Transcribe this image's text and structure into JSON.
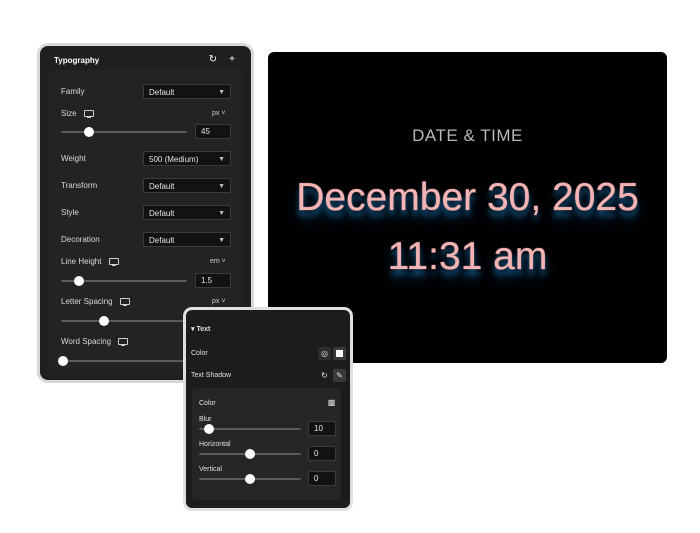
{
  "typography": {
    "title": "Typography",
    "reset_icon": "↻",
    "add_icon": "+",
    "family": {
      "label": "Family",
      "value": "Default"
    },
    "size": {
      "label": "Size",
      "unit": "px",
      "value": "45",
      "slider_fraction": 0.22
    },
    "weight": {
      "label": "Weight",
      "value": "500 (Medium)"
    },
    "transform": {
      "label": "Transform",
      "value": "Default"
    },
    "style": {
      "label": "Style",
      "value": "Default"
    },
    "decoration": {
      "label": "Decoration",
      "value": "Default"
    },
    "line_height": {
      "label": "Line Height",
      "unit": "em",
      "value": "1.5",
      "slider_fraction": 0.14
    },
    "letter_spacing": {
      "label": "Letter Spacing",
      "unit": "px",
      "slider_fraction": 0.34
    },
    "word_spacing": {
      "label": "Word Spacing",
      "slider_fraction": 0.0
    }
  },
  "preview": {
    "label": "DATE & TIME",
    "date": "December 30, 2025",
    "time": "11:31 am",
    "text_color": "#f4b4b4",
    "shadow_color": "#2a8fd6"
  },
  "text_panel": {
    "title": "Text",
    "color_label": "Color",
    "text_shadow_label": "Text Shadow",
    "shadow": {
      "color_label": "Color",
      "blur": {
        "label": "Blur",
        "value": "10",
        "slider_fraction": 0.1
      },
      "horizontal": {
        "label": "Horizontal",
        "value": "0",
        "slider_fraction": 0.5
      },
      "vertical": {
        "label": "Vertical",
        "value": "0",
        "slider_fraction": 0.5
      }
    }
  }
}
